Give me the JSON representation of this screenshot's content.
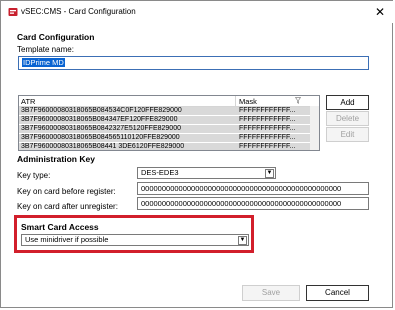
{
  "window": {
    "title": "vSEC:CMS - Card Configuration",
    "close_glyph": "✕"
  },
  "card_configuration": {
    "heading": "Card Configuration",
    "template_name_label": "Template name:",
    "template_name_value": "IDPrime MD"
  },
  "atr_list": {
    "columns": [
      "ATR",
      "Mask"
    ],
    "rows": [
      {
        "atr": "3B7F96000080318065B084534C0F120FFE829000",
        "mask": "FFFFFFFFFFFF..."
      },
      {
        "atr": "3B7F96000080318065B084347EF120FFE829000",
        "mask": "FFFFFFFFFFFF..."
      },
      {
        "atr": "3B7F96000080318065B0842327E5120FFE829000",
        "mask": "FFFFFFFFFFFF..."
      },
      {
        "atr": "3B7F96000080318065B084565110120FFE829000",
        "mask": "FFFFFFFFFFFF..."
      },
      {
        "atr": "3B7F96000080318065B08441 3DE6120FFE829000",
        "mask": "FFFFFFFFFFFF..."
      }
    ],
    "buttons": {
      "add": "Add",
      "delete": "Delete",
      "edit": "Edit"
    }
  },
  "administration_key": {
    "heading": "Administration Key",
    "key_type_label": "Key type:",
    "key_type_value": "DES-EDE3",
    "before_register_label": "Key on card before register:",
    "before_register_value": "000000000000000000000000000000000000000000000000",
    "after_unregister_label": "Key on card after unregister:",
    "after_unregister_value": "000000000000000000000000000000000000000000000000"
  },
  "smart_card_access": {
    "heading": "Smart Card Access",
    "mode_value": "Use minidriver if possible",
    "highlight_color": "#d21f2b"
  },
  "footer": {
    "save": "Save",
    "cancel": "Cancel"
  }
}
